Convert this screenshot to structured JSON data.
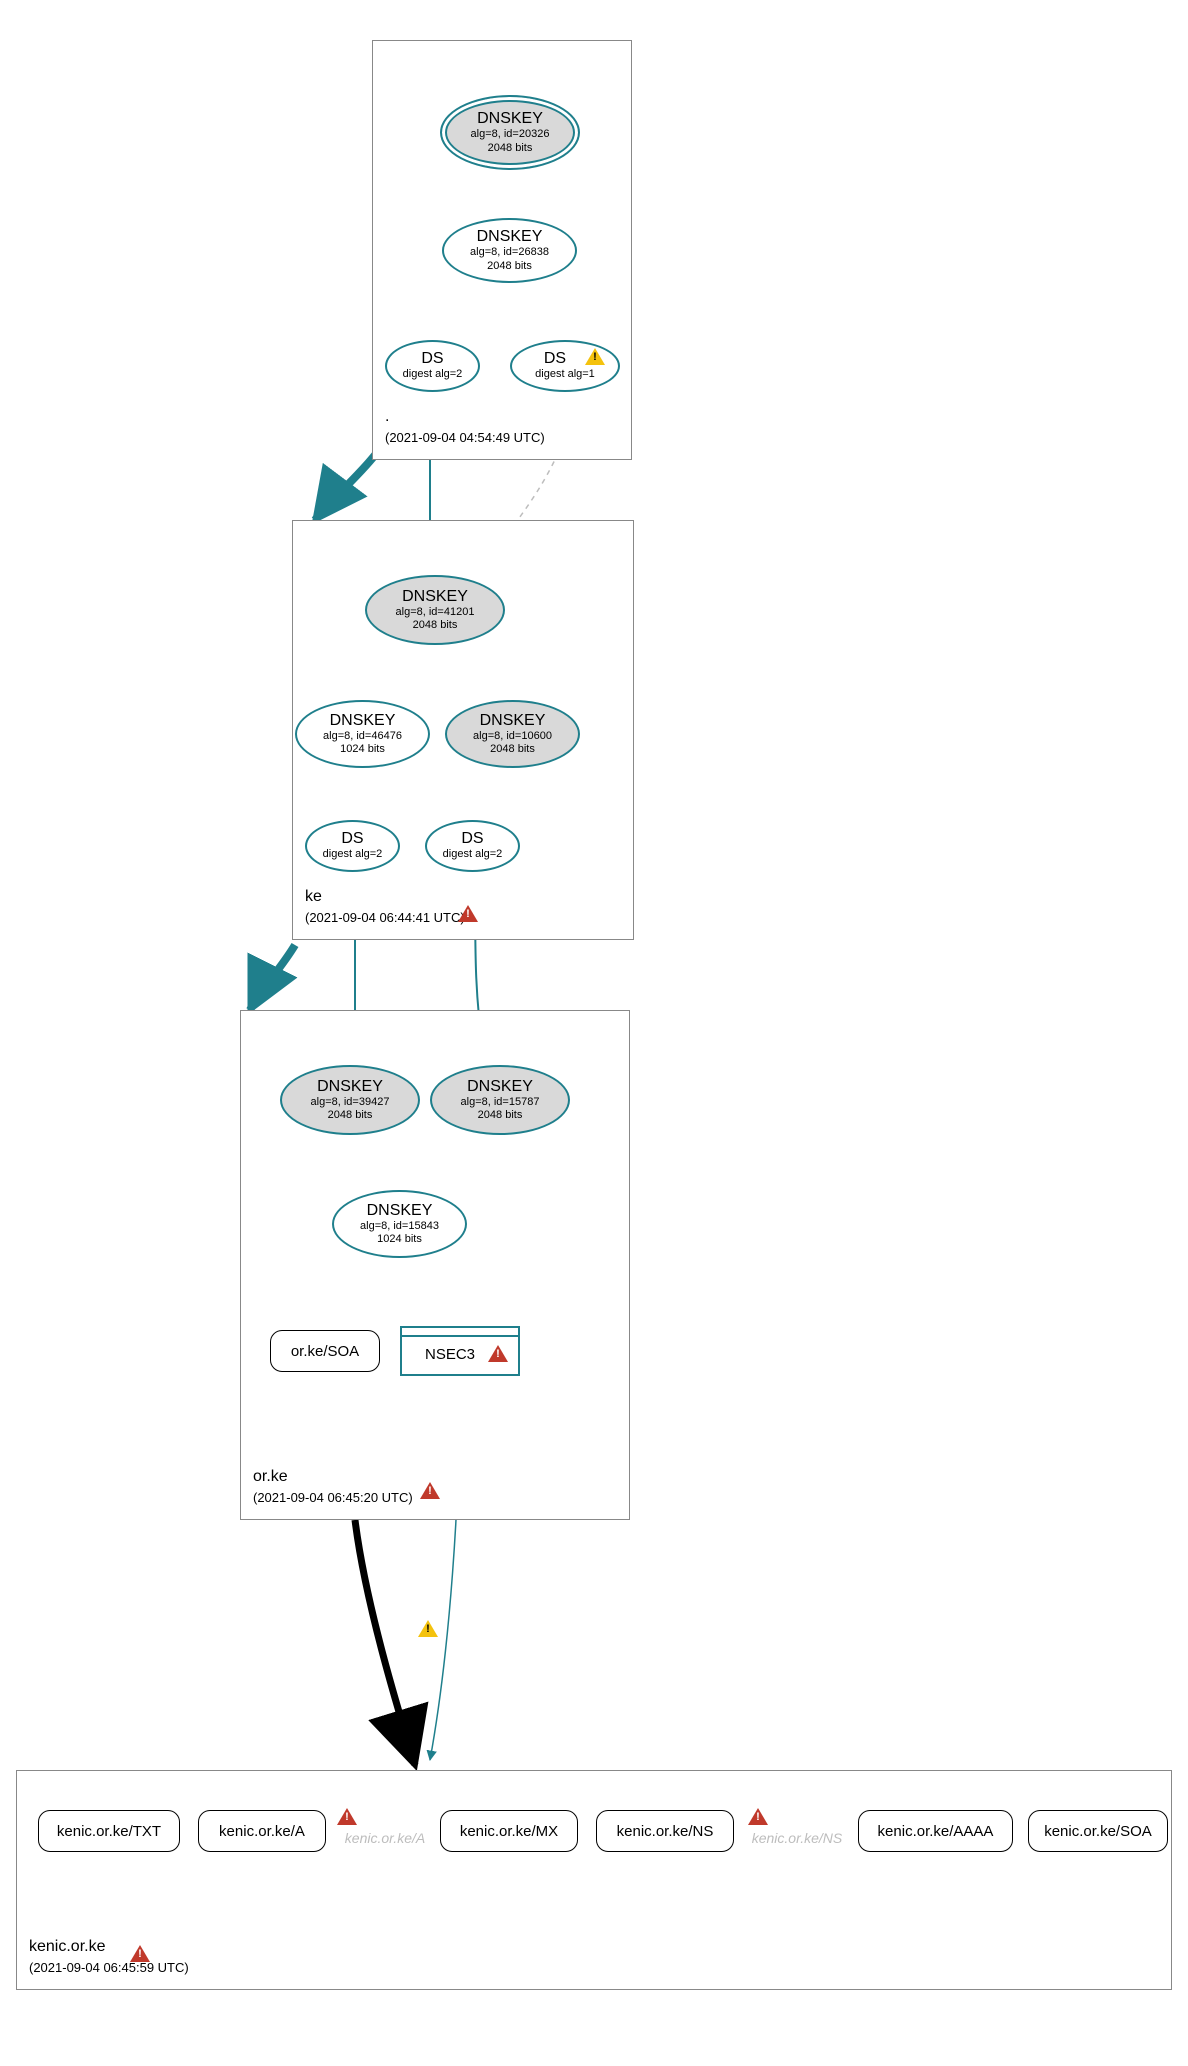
{
  "zones": {
    "root": {
      "name": ".",
      "timestamp": "(2021-09-04 04:54:49 UTC)"
    },
    "ke": {
      "name": "ke",
      "timestamp": "(2021-09-04 06:44:41 UTC)"
    },
    "orke": {
      "name": "or.ke",
      "timestamp": "(2021-09-04 06:45:20 UTC)"
    },
    "leaf": {
      "name": "kenic.or.ke",
      "timestamp": "(2021-09-04 06:45:59 UTC)"
    }
  },
  "nodes": {
    "root_ksk": {
      "title": "DNSKEY",
      "line1": "alg=8, id=20326",
      "line2": "2048 bits"
    },
    "root_zsk": {
      "title": "DNSKEY",
      "line1": "alg=8, id=26838",
      "line2": "2048 bits"
    },
    "root_ds2": {
      "title": "DS",
      "line1": "digest alg=2"
    },
    "root_ds1": {
      "title": "DS",
      "line1": "digest alg=1"
    },
    "ke_ksk": {
      "title": "DNSKEY",
      "line1": "alg=8, id=41201",
      "line2": "2048 bits"
    },
    "ke_zsk": {
      "title": "DNSKEY",
      "line1": "alg=8, id=46476",
      "line2": "1024 bits"
    },
    "ke_key2": {
      "title": "DNSKEY",
      "line1": "alg=8, id=10600",
      "line2": "2048 bits"
    },
    "ke_ds_a": {
      "title": "DS",
      "line1": "digest alg=2"
    },
    "ke_ds_b": {
      "title": "DS",
      "line1": "digest alg=2"
    },
    "orke_ksk1": {
      "title": "DNSKEY",
      "line1": "alg=8, id=39427",
      "line2": "2048 bits"
    },
    "orke_ksk2": {
      "title": "DNSKEY",
      "line1": "alg=8, id=15787",
      "line2": "2048 bits"
    },
    "orke_zsk": {
      "title": "DNSKEY",
      "line1": "alg=8, id=15843",
      "line2": "1024 bits"
    },
    "orke_soa": {
      "label": "or.ke/SOA"
    },
    "orke_nsec3": {
      "label": "NSEC3"
    },
    "leaf_txt": {
      "label": "kenic.or.ke/TXT"
    },
    "leaf_a": {
      "label": "kenic.or.ke/A"
    },
    "leaf_ghostA": {
      "label": "kenic.or.ke/A"
    },
    "leaf_mx": {
      "label": "kenic.or.ke/MX"
    },
    "leaf_ns": {
      "label": "kenic.or.ke/NS"
    },
    "leaf_ghostNS": {
      "label": "kenic.or.ke/NS"
    },
    "leaf_aaaa": {
      "label": "kenic.or.ke/AAAA"
    },
    "leaf_soa": {
      "label": "kenic.or.ke/SOA"
    }
  },
  "chart_data": {
    "type": "dnssec-delegation-graph",
    "domain": "kenic.or.ke",
    "zones": [
      {
        "zone": ".",
        "observed": "2021-09-04 04:54:49 UTC",
        "status": "secure"
      },
      {
        "zone": "ke",
        "observed": "2021-09-04 06:44:41 UTC",
        "status": "error"
      },
      {
        "zone": "or.ke",
        "observed": "2021-09-04 06:45:20 UTC",
        "status": "error"
      },
      {
        "zone": "kenic.or.ke",
        "observed": "2021-09-04 06:45:59 UTC",
        "status": "error"
      }
    ],
    "keys": [
      {
        "zone": ".",
        "type": "DNSKEY",
        "alg": 8,
        "id": 20326,
        "bits": 2048,
        "role": "KSK",
        "sep": true,
        "self_signed": true
      },
      {
        "zone": ".",
        "type": "DNSKEY",
        "alg": 8,
        "id": 26838,
        "bits": 2048,
        "role": "ZSK"
      },
      {
        "zone": "ke",
        "type": "DNSKEY",
        "alg": 8,
        "id": 41201,
        "bits": 2048,
        "role": "KSK",
        "sep": true,
        "self_signed": true
      },
      {
        "zone": "ke",
        "type": "DNSKEY",
        "alg": 8,
        "id": 46476,
        "bits": 1024,
        "role": "ZSK"
      },
      {
        "zone": "ke",
        "type": "DNSKEY",
        "alg": 8,
        "id": 10600,
        "bits": 2048,
        "sep": true,
        "self_signed": true
      },
      {
        "zone": "or.ke",
        "type": "DNSKEY",
        "alg": 8,
        "id": 39427,
        "bits": 2048,
        "role": "KSK",
        "sep": true,
        "self_signed": true
      },
      {
        "zone": "or.ke",
        "type": "DNSKEY",
        "alg": 8,
        "id": 15787,
        "bits": 2048,
        "role": "KSK",
        "sep": true,
        "self_signed": true
      },
      {
        "zone": "or.ke",
        "type": "DNSKEY",
        "alg": 8,
        "id": 15843,
        "bits": 1024,
        "role": "ZSK"
      }
    ],
    "ds": [
      {
        "parent": ".",
        "child": "ke",
        "digest_alg": 2,
        "status": "secure"
      },
      {
        "parent": ".",
        "child": "ke",
        "digest_alg": 1,
        "status": "warning"
      },
      {
        "parent": "ke",
        "child": "or.ke",
        "digest_alg": 2,
        "status": "secure"
      },
      {
        "parent": "ke",
        "child": "or.ke",
        "digest_alg": 2,
        "status": "secure"
      }
    ],
    "rrsets": [
      {
        "zone": "or.ke",
        "name": "or.ke/SOA"
      },
      {
        "zone": "or.ke",
        "name": "NSEC3",
        "status": "error"
      },
      {
        "zone": "kenic.or.ke",
        "name": "kenic.or.ke/TXT"
      },
      {
        "zone": "kenic.or.ke",
        "name": "kenic.or.ke/A"
      },
      {
        "zone": "kenic.or.ke",
        "name": "kenic.or.ke/A",
        "status": "error",
        "missing": true
      },
      {
        "zone": "kenic.or.ke",
        "name": "kenic.or.ke/MX"
      },
      {
        "zone": "kenic.or.ke",
        "name": "kenic.or.ke/NS"
      },
      {
        "zone": "kenic.or.ke",
        "name": "kenic.or.ke/NS",
        "status": "error",
        "missing": true
      },
      {
        "zone": "kenic.or.ke",
        "name": "kenic.or.ke/AAAA"
      },
      {
        "zone": "kenic.or.ke",
        "name": "kenic.or.ke/SOA"
      }
    ],
    "edges": [
      {
        "from": "./DNSKEY/20326",
        "to": "./DNSKEY/20326",
        "kind": "self-sig"
      },
      {
        "from": "./DNSKEY/20326",
        "to": "./DNSKEY/26838",
        "kind": "rrsig"
      },
      {
        "from": "./DNSKEY/26838",
        "to": "./DS(alg=2)",
        "kind": "rrsig"
      },
      {
        "from": "./DNSKEY/26838",
        "to": "./DS(alg=1)",
        "kind": "rrsig"
      },
      {
        "from": "./DS(alg=2)",
        "to": "ke/DNSKEY/41201",
        "kind": "ds"
      },
      {
        "from": "./DS(alg=1)",
        "to": "ke/DNSKEY/41201",
        "kind": "ds",
        "status": "insecure"
      },
      {
        "from": ".",
        "to": "ke",
        "kind": "delegation"
      },
      {
        "from": "ke/DNSKEY/41201",
        "to": "ke/DNSKEY/41201",
        "kind": "self-sig"
      },
      {
        "from": "ke/DNSKEY/41201",
        "to": "ke/DNSKEY/46476",
        "kind": "rrsig"
      },
      {
        "from": "ke/DNSKEY/41201",
        "to": "ke/DNSKEY/10600",
        "kind": "rrsig"
      },
      {
        "from": "ke/DNSKEY/10600",
        "to": "ke/DNSKEY/10600",
        "kind": "self-sig"
      },
      {
        "from": "ke/DNSKEY/46476",
        "to": "ke/DS(a)",
        "kind": "rrsig"
      },
      {
        "from": "ke/DNSKEY/46476",
        "to": "ke/DS(b)",
        "kind": "rrsig"
      },
      {
        "from": "ke/DS(a)",
        "to": "or.ke/DNSKEY/39427",
        "kind": "ds"
      },
      {
        "from": "ke/DS(b)",
        "to": "or.ke/DNSKEY/15787",
        "kind": "ds"
      },
      {
        "from": "ke",
        "to": "or.ke",
        "kind": "delegation"
      },
      {
        "from": "or.ke/DNSKEY/39427",
        "to": "or.ke/DNSKEY/39427",
        "kind": "self-sig"
      },
      {
        "from": "or.ke/DNSKEY/15787",
        "to": "or.ke/DNSKEY/15787",
        "kind": "self-sig"
      },
      {
        "from": "or.ke/DNSKEY/39427",
        "to": "or.ke/DNSKEY/15843",
        "kind": "rrsig"
      },
      {
        "from": "or.ke/DNSKEY/15787",
        "to": "or.ke/DNSKEY/15843",
        "kind": "rrsig"
      },
      {
        "from": "or.ke/DNSKEY/15843",
        "to": "or.ke/SOA",
        "kind": "rrsig"
      },
      {
        "from": "or.ke/DNSKEY/15843",
        "to": "or.ke/NSEC3",
        "kind": "rrsig"
      },
      {
        "from": "or.ke/NSEC3",
        "to": "kenic.or.ke",
        "kind": "nsec-denial"
      },
      {
        "from": "or.ke",
        "to": "kenic.or.ke",
        "kind": "delegation",
        "status": "warning"
      }
    ]
  }
}
